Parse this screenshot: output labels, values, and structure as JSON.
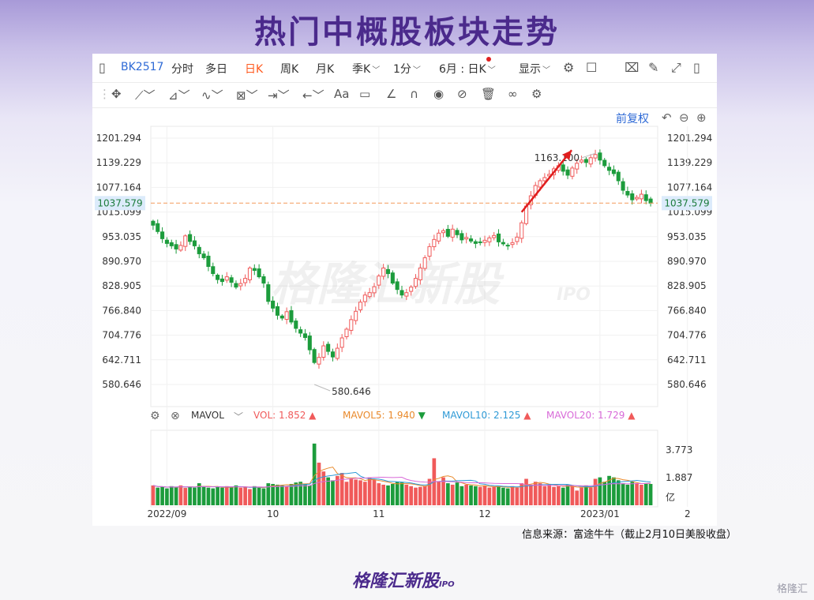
{
  "title": "热门中概股板块走势",
  "toolbar": {
    "code": "BK2517",
    "items": [
      "分时",
      "多日",
      "日K",
      "周K",
      "月K",
      "季K",
      "1分",
      "6月 : 日K",
      "显示"
    ],
    "selected": "日K"
  },
  "fuquan": "前复权",
  "vol_legend": {
    "name": "MAVOL",
    "vol": "VOL: 1.852",
    "ma5": "MAVOL5: 1.940",
    "ma10": "MAVOL10: 2.125",
    "ma20": "MAVOL20: 1.729"
  },
  "source": "信息来源：富途牛牛（截止2月10日美股收盘）",
  "watermark": "格隆汇新股",
  "watermark_sub": "IPO",
  "logo": "格隆汇新股",
  "logo_sub": "IPO",
  "corner_mark": "格隆汇",
  "colors": {
    "up": "#f05a5a",
    "down": "#1c9c3c",
    "ref_line": "#f39a5c",
    "arrow": "#e01e1e"
  },
  "chart_data": {
    "type": "candlestick",
    "y_ticks": [
      1201.294,
      1139.229,
      1077.164,
      1015.099,
      953.035,
      890.97,
      828.905,
      766.84,
      704.776,
      642.711,
      580.646
    ],
    "y_tick_labels": [
      "1201.294",
      "1139.229",
      "1077.164",
      "1015.099",
      "953.035",
      "890.970",
      "828.905",
      "766.840",
      "704.776",
      "642.711",
      "580.646"
    ],
    "current_price": 1037.579,
    "current_label": "1037.579",
    "high": {
      "value": 1163.1,
      "label": "1163.100"
    },
    "low": {
      "value": 580.646,
      "label": "580.646"
    },
    "x_labels": [
      "2022/09",
      "10",
      "11",
      "12",
      "2023/01",
      "2"
    ],
    "x_label_index": [
      3,
      26,
      49,
      72,
      97,
      116
    ],
    "closes": [
      982,
      966,
      948,
      936,
      930,
      922,
      931,
      955,
      941,
      930,
      910,
      900,
      878,
      860,
      845,
      840,
      852,
      838,
      826,
      835,
      848,
      874,
      868,
      852,
      836,
      790,
      773,
      755,
      748,
      764,
      738,
      722,
      710,
      699,
      668,
      636,
      649,
      678,
      664,
      650,
      672,
      698,
      720,
      744,
      765,
      788,
      806,
      812,
      827,
      854,
      874,
      860,
      836,
      820,
      806,
      812,
      826,
      848,
      874,
      900,
      928,
      946,
      962,
      968,
      954,
      972,
      958,
      945,
      951,
      942,
      936,
      938,
      944,
      950,
      956,
      940,
      935,
      931,
      938,
      952,
      988,
      1030,
      1056,
      1082,
      1094,
      1102,
      1110,
      1124,
      1132,
      1118,
      1108,
      1126,
      1138,
      1146,
      1140,
      1152,
      1160,
      1146,
      1132,
      1120,
      1112,
      1094,
      1070,
      1058,
      1046,
      1052,
      1060,
      1044,
      1037.579
    ],
    "volume_axis": [
      "3.773",
      "1.887",
      "亿"
    ],
    "volume_axis_values": [
      3.773,
      1.887
    ],
    "volumes": [
      1.35,
      1.2,
      1.25,
      1.15,
      1.3,
      1.22,
      1.35,
      1.18,
      1.25,
      1.2,
      1.5,
      1.3,
      1.2,
      1.15,
      1.25,
      1.2,
      1.3,
      1.22,
      1.35,
      1.2,
      1.25,
      1.1,
      1.3,
      1.2,
      1.15,
      1.5,
      1.45,
      1.4,
      1.35,
      1.3,
      1.45,
      1.55,
      1.6,
      1.4,
      1.35,
      4.2,
      2.9,
      2.3,
      1.9,
      1.7,
      2.0,
      2.2,
      1.6,
      1.8,
      1.75,
      1.7,
      1.6,
      1.9,
      1.75,
      1.5,
      1.4,
      1.35,
      1.45,
      1.6,
      1.55,
      1.4,
      1.3,
      1.2,
      1.25,
      1.3,
      1.8,
      3.2,
      1.6,
      1.9,
      1.5,
      1.4,
      1.55,
      1.3,
      1.4,
      1.35,
      1.3,
      1.25,
      1.35,
      1.2,
      1.25,
      1.3,
      1.2,
      1.15,
      1.3,
      1.2,
      1.5,
      1.8,
      1.4,
      1.6,
      1.5,
      1.3,
      1.4,
      1.25,
      1.3,
      1.2,
      1.4,
      1.3,
      1.0,
      1.2,
      1.35,
      1.2,
      1.8,
      1.9,
      1.6,
      2.0,
      1.9,
      1.7,
      1.5,
      1.4,
      1.6,
      1.5,
      1.4,
      1.5,
      1.45
    ]
  }
}
